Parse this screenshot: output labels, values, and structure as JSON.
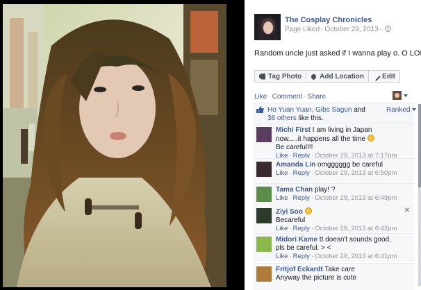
{
  "page": {
    "name": "The Cosplay Chronicles",
    "liked_label": "Page Liked",
    "date": "October 29, 2013",
    "globe_icon": "globe-icon"
  },
  "caption": "Random uncle just asked if I wanna play o. O LOL",
  "actions": {
    "tag_photo": "Tag Photo",
    "add_location": "Add Location",
    "edit": "Edit"
  },
  "ufi": {
    "like": "Like",
    "comment": "Comment",
    "share": "Share",
    "dot": "·"
  },
  "likes": {
    "names": "Ho Yuan Yuan, Gibs Sagun",
    "and": "and",
    "others_link": "38 others",
    "suffix": "like this.",
    "ranked": "Ranked"
  },
  "comments": [
    {
      "author": "Michi First",
      "text_1": "I am living in Japan now.....it happens all the time",
      "text_2": "Be careful!!!",
      "like": "Like",
      "reply": "Reply",
      "time": "October 29, 2013 at 7:17pm",
      "avatar_color": "#5a3f5e"
    },
    {
      "author": "Amanda Lin",
      "text_1": "omgggggg be careful",
      "like": "Like",
      "reply": "Reply",
      "time": "October 29, 2013 at 6:50pm",
      "avatar_color": "#3a2a2e"
    },
    {
      "author": "Tama Chan",
      "text_1": "play! ?",
      "like": "Like",
      "reply": "Reply",
      "time": "October 29, 2013 at 6:49pm",
      "avatar_color": "#5b8c4a"
    },
    {
      "author": "Ziyi Soo",
      "text_1": "Becareful",
      "like": "Like",
      "reply": "Reply",
      "time": "October 29, 2013 at 6:42pm",
      "avatar_color": "#2d3b2a",
      "close": "✕"
    },
    {
      "author": "Midori Kame",
      "text_1": "tt doesn't sounds good, pls be careful. > <",
      "like": "Like",
      "reply": "Reply",
      "time": "October 29, 2013 at 6:41pm",
      "avatar_color": "#8ab84a"
    },
    {
      "author": "Fritjof Eckardt",
      "text_1": "Take care",
      "text_2": "Anyway the picture is cute",
      "avatar_color": "#b07a3a"
    }
  ],
  "colors": {
    "link": "#3b5998",
    "meta": "#90949c",
    "panel": "#f6f7f9"
  }
}
